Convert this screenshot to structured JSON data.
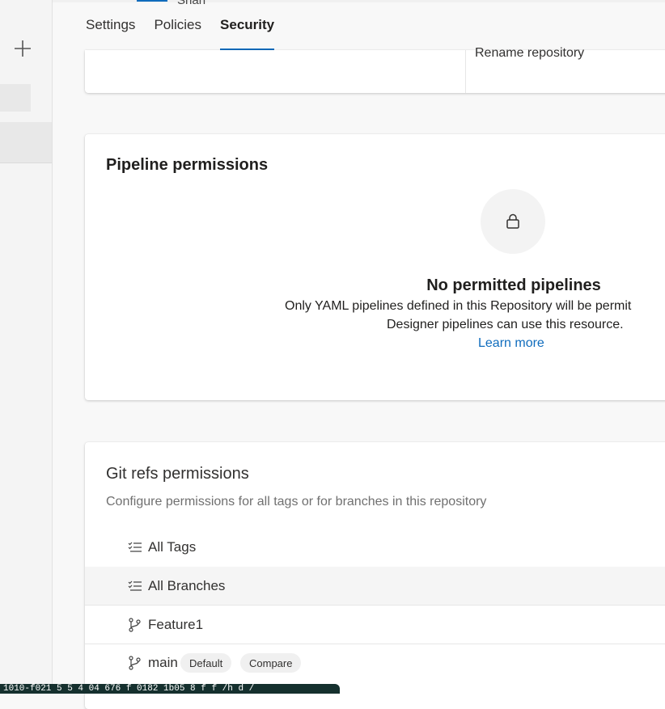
{
  "header": {
    "cut_text": "Shan",
    "tabs": [
      {
        "label": "Settings"
      },
      {
        "label": "Policies"
      },
      {
        "label": "Security"
      }
    ]
  },
  "top_card": {
    "rename_label": "Rename repository"
  },
  "pipeline_permissions": {
    "title": "Pipeline permissions",
    "empty_title": "No permitted pipelines",
    "empty_desc_line1": "Only YAML pipelines defined in this Repository will be permit",
    "empty_desc_line2": "Designer pipelines can use this resource.",
    "learn_more": "Learn more"
  },
  "git_refs": {
    "title": "Git refs permissions",
    "subtitle": "Configure permissions for all tags or for branches in this repository",
    "rows": [
      {
        "label": "All Tags"
      },
      {
        "label": "All Branches"
      },
      {
        "label": "Feature1"
      },
      {
        "label": "main"
      }
    ],
    "default_badge": "Default",
    "compare_button": "Compare"
  },
  "statusbar": {
    "text": "1010-f021 5 5 4 04 676 f 0182 1b05 8 f f /h d /"
  },
  "colors": {
    "accent": "#0f6cbd",
    "background": "#f8f8f8",
    "card": "#ffffff"
  }
}
